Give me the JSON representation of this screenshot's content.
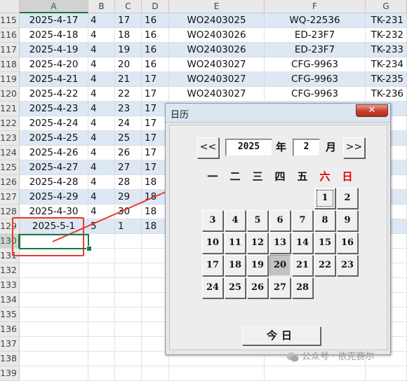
{
  "sheet": {
    "columns": [
      "A",
      "B",
      "C",
      "D",
      "E",
      "F",
      "G"
    ],
    "selected_column": "A",
    "rows": [
      {
        "n": "115",
        "a": "2025-4-17",
        "b": "4",
        "c": "17",
        "d": "16",
        "e": "WO2403025",
        "f": "WQ-22536",
        "g": "TK-231"
      },
      {
        "n": "116",
        "a": "2025-4-18",
        "b": "4",
        "c": "18",
        "d": "16",
        "e": "WO2403026",
        "f": "ED-23F7",
        "g": "TK-232"
      },
      {
        "n": "117",
        "a": "2025-4-19",
        "b": "4",
        "c": "19",
        "d": "16",
        "e": "WO2403026",
        "f": "ED-23F7",
        "g": "TK-233"
      },
      {
        "n": "118",
        "a": "2025-4-20",
        "b": "4",
        "c": "20",
        "d": "16",
        "e": "WO2403027",
        "f": "CFG-9963",
        "g": "TK-234"
      },
      {
        "n": "119",
        "a": "2025-4-21",
        "b": "4",
        "c": "21",
        "d": "17",
        "e": "WO2403027",
        "f": "CFG-9963",
        "g": "TK-235"
      },
      {
        "n": "120",
        "a": "2025-4-22",
        "b": "4",
        "c": "22",
        "d": "17",
        "e": "WO2403027",
        "f": "CFG-9963",
        "g": "TK-236"
      },
      {
        "n": "121",
        "a": "2025-4-23",
        "b": "4",
        "c": "23",
        "d": "17",
        "e": "",
        "f": "",
        "g": ""
      },
      {
        "n": "122",
        "a": "2025-4-24",
        "b": "4",
        "c": "24",
        "d": "17",
        "e": "",
        "f": "",
        "g": ""
      },
      {
        "n": "123",
        "a": "2025-4-25",
        "b": "4",
        "c": "25",
        "d": "17",
        "e": "",
        "f": "",
        "g": ""
      },
      {
        "n": "124",
        "a": "2025-4-26",
        "b": "4",
        "c": "26",
        "d": "17",
        "e": "",
        "f": "",
        "g": ""
      },
      {
        "n": "125",
        "a": "2025-4-27",
        "b": "4",
        "c": "27",
        "d": "17",
        "e": "",
        "f": "",
        "g": ""
      },
      {
        "n": "126",
        "a": "2025-4-28",
        "b": "4",
        "c": "28",
        "d": "18",
        "e": "",
        "f": "",
        "g": ""
      },
      {
        "n": "127",
        "a": "2025-4-29",
        "b": "4",
        "c": "29",
        "d": "18",
        "e": "",
        "f": "",
        "g": ""
      },
      {
        "n": "128",
        "a": "2025-4-30",
        "b": "4",
        "c": "30",
        "d": "18",
        "e": "",
        "f": "",
        "g": ""
      },
      {
        "n": "129",
        "a": "2025-5-1",
        "b": "5",
        "c": "1",
        "d": "18",
        "e": "",
        "f": "",
        "g": ""
      },
      {
        "n": "130",
        "a": "",
        "b": "",
        "c": "",
        "d": "",
        "e": "",
        "f": "",
        "g": ""
      },
      {
        "n": "131",
        "a": "",
        "b": "",
        "c": "",
        "d": "",
        "e": "",
        "f": "",
        "g": ""
      },
      {
        "n": "132",
        "a": "",
        "b": "",
        "c": "",
        "d": "",
        "e": "",
        "f": "",
        "g": ""
      },
      {
        "n": "133",
        "a": "",
        "b": "",
        "c": "",
        "d": "",
        "e": "",
        "f": "",
        "g": ""
      },
      {
        "n": "134",
        "a": "",
        "b": "",
        "c": "",
        "d": "",
        "e": "",
        "f": "",
        "g": ""
      },
      {
        "n": "135",
        "a": "",
        "b": "",
        "c": "",
        "d": "",
        "e": "",
        "f": "",
        "g": ""
      },
      {
        "n": "136",
        "a": "",
        "b": "",
        "c": "",
        "d": "",
        "e": "",
        "f": "",
        "g": ""
      },
      {
        "n": "137",
        "a": "",
        "b": "",
        "c": "",
        "d": "",
        "e": "",
        "f": "",
        "g": ""
      },
      {
        "n": "138",
        "a": "",
        "b": "",
        "c": "",
        "d": "",
        "e": "",
        "f": "",
        "g": ""
      },
      {
        "n": "139",
        "a": "",
        "b": "",
        "c": "",
        "d": "",
        "e": "",
        "f": "",
        "g": ""
      }
    ],
    "active_row": "130",
    "colors": {
      "band": "#dde8f4",
      "accent": "#217346",
      "annotation": "#ea3a2a"
    }
  },
  "calendar": {
    "title": "日历",
    "close_label": "✕",
    "prev_label": "<<",
    "next_label": ">>",
    "year": "2025",
    "year_unit": "年",
    "month": "2",
    "month_unit": "月",
    "weekdays": [
      "一",
      "二",
      "三",
      "四",
      "五",
      "六",
      "日"
    ],
    "weekend_color": "#e00000",
    "days": [
      "1",
      "2",
      "3",
      "4",
      "5",
      "6",
      "7",
      "8",
      "9",
      "10",
      "11",
      "12",
      "13",
      "14",
      "15",
      "16",
      "17",
      "18",
      "19",
      "20",
      "21",
      "22",
      "23",
      "24",
      "25",
      "26",
      "27",
      "28"
    ],
    "first_weekday_index": 5,
    "highlighted_day": "20",
    "focused_day": "1",
    "today_label": "今日"
  },
  "watermark": {
    "text": "公众号 · 依克赛尔"
  }
}
